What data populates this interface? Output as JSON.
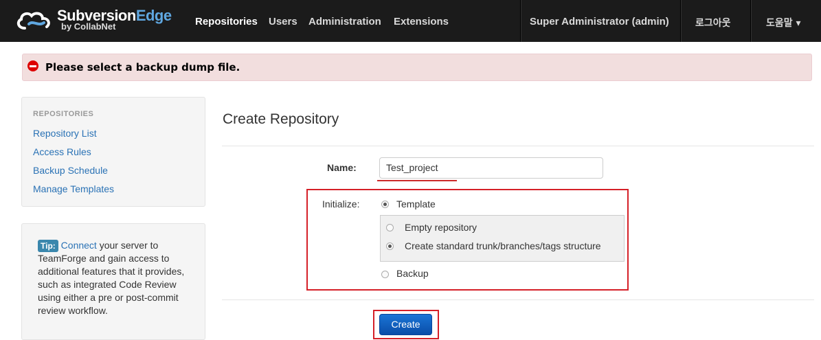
{
  "brand": {
    "name_main": "Subversion",
    "name_accent": "Edge",
    "subtitle": "by CollabNet"
  },
  "nav": {
    "items": [
      "Repositories",
      "Users",
      "Administration",
      "Extensions"
    ],
    "user": "Super Administrator (admin)",
    "logout": "로그아웃",
    "help": "도움말 ▾"
  },
  "alert": {
    "message": "Please select a backup dump file."
  },
  "sidebar": {
    "heading": "REPOSITORIES",
    "links": [
      "Repository List",
      "Access Rules",
      "Backup Schedule",
      "Manage Templates"
    ]
  },
  "tip": {
    "badge": "Tip:",
    "link": "Connect",
    "text": " your server to TeamForge and gain access to additional features that it provides, such as integrated Code Review using either a pre or post-commit review workflow."
  },
  "form": {
    "title": "Create Repository",
    "name_label": "Name:",
    "name_value": "Test_project",
    "init_label": "Initialize:",
    "template_label": "Template",
    "empty_label": "Empty repository",
    "standard_label": "Create standard trunk/branches/tags structure",
    "backup_label": "Backup",
    "submit_label": "Create"
  },
  "colors": {
    "accent": "#5fa7e0",
    "link": "#2a72b5",
    "highlight": "#d51f27",
    "alert_bg": "#f2dede"
  }
}
